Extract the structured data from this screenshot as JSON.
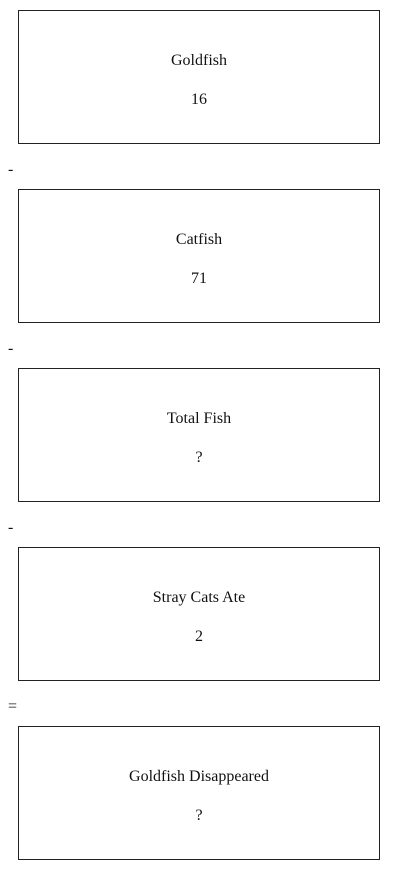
{
  "boxes": [
    {
      "label": "Goldfish",
      "value": "16"
    },
    {
      "label": "Catfish",
      "value": "71"
    },
    {
      "label": "Total Fish",
      "value": "?"
    },
    {
      "label": "Stray Cats Ate",
      "value": "2"
    },
    {
      "label": "Goldfish Disappeared",
      "value": "?"
    }
  ],
  "operators": [
    "-",
    "-",
    "-",
    "="
  ]
}
